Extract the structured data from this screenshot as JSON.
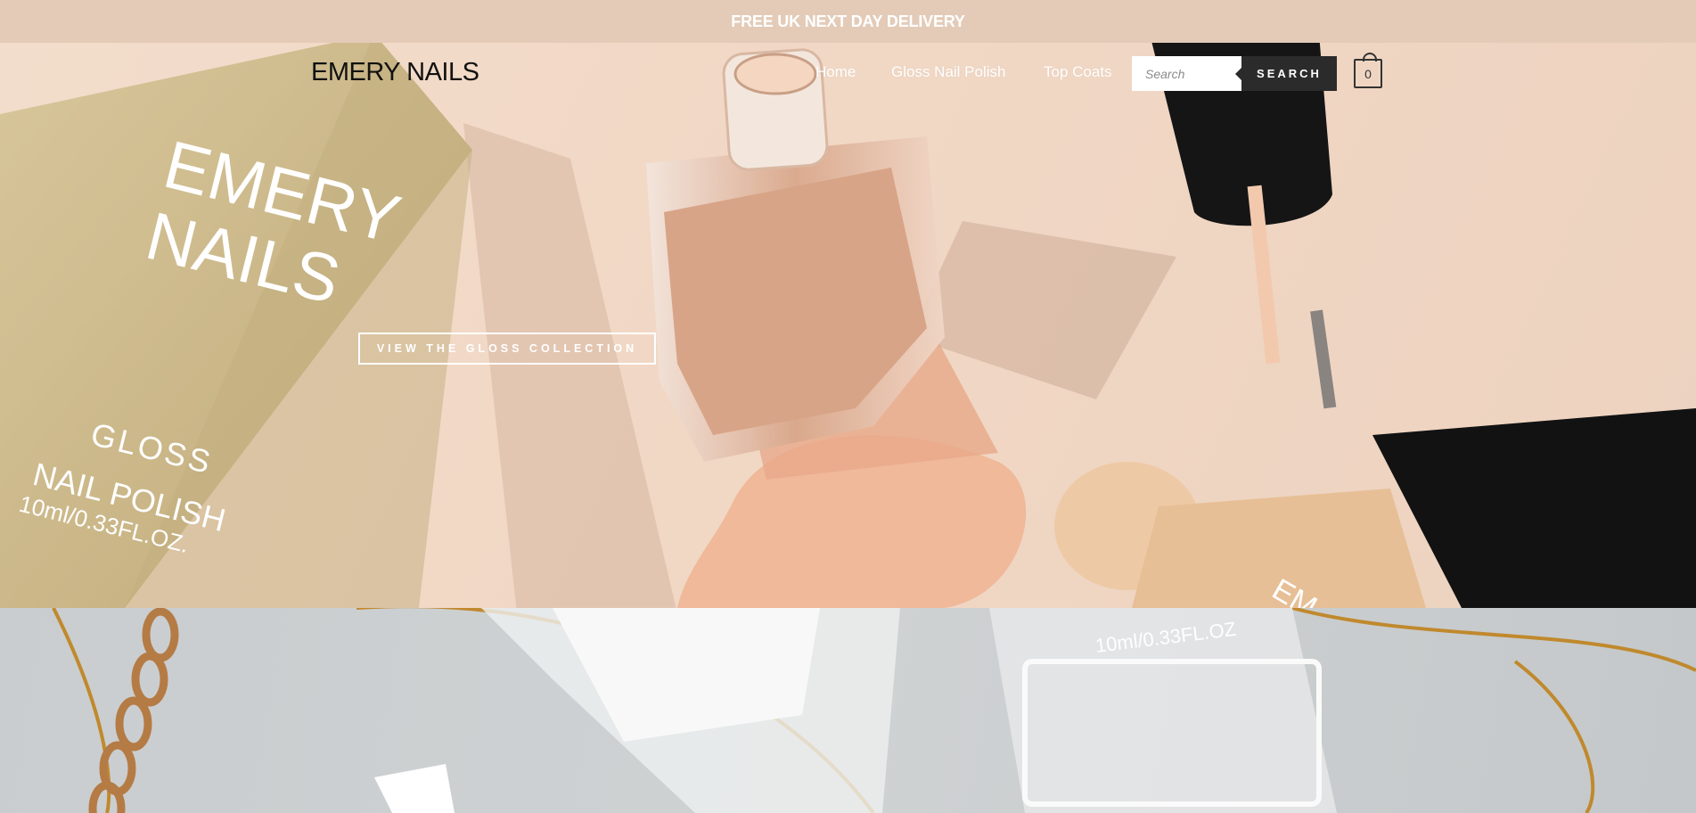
{
  "announcement": {
    "text": "FREE UK NEXT DAY DELIVERY"
  },
  "header": {
    "logo": "EMERY NAILS",
    "nav": [
      {
        "label": "Home"
      },
      {
        "label": "Gloss Nail Polish"
      },
      {
        "label": "Top Coats"
      }
    ],
    "search": {
      "placeholder": "Search",
      "button_label": "SEARCH"
    },
    "cart": {
      "count": "0"
    }
  },
  "hero": {
    "cta_label": "VIEW THE GLOSS COLLECTION",
    "box_text": {
      "brand_line1": "EMERY",
      "brand_line2": "NAILS",
      "product_line1": "GLOSS",
      "product_line2": "NAIL POLISH",
      "size": "10ml/0.33FL.OZ."
    },
    "bottle_label": "EM"
  },
  "lower": {
    "bottle_size": "10ml/0.33FL.OZ"
  },
  "colors": {
    "announcement_bg": "#e3cbb8",
    "hero_bg": "#f1d8c5",
    "search_button": "#2b2b2b",
    "box_gold": "#cdb98c"
  }
}
